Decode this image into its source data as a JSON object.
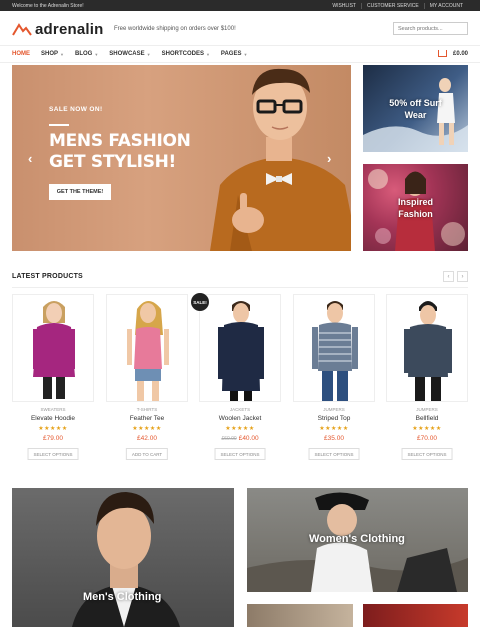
{
  "topbar": {
    "welcome": "Welcome to the Adrenalin Store!",
    "links": [
      "WISHLIST",
      "CUSTOMER SERVICE",
      "MY ACCOUNT"
    ]
  },
  "header": {
    "logo": "adrenalin",
    "tagline": "Free worldwide shipping on orders over $100!",
    "search_placeholder": "Search products..."
  },
  "nav": {
    "items": [
      "HOME",
      "SHOP",
      "BLOG",
      "SHOWCASE",
      "SHORTCODES",
      "PAGES"
    ],
    "cart_total": "£0.00",
    "accent": "#e4572e"
  },
  "hero": {
    "sale_tag": "SALE NOW ON!",
    "title": "MENS FASHION\nGET STYLISH!",
    "button": "GET THE THEME!",
    "prev_arrow": "‹",
    "next_arrow": "›"
  },
  "side_banners": [
    {
      "label": "50% off Surf\nWear"
    },
    {
      "label": "Inspired\nFashion"
    }
  ],
  "latest": {
    "title": "LATEST PRODUCTS",
    "prev": "‹",
    "next": "›",
    "sale_badge": "SALE!",
    "products": [
      {
        "category": "SWEATERS",
        "name": "Elevate Hoodie",
        "stars": "★★★★★",
        "price": "£79.00",
        "old_price": "",
        "action": "SELECT OPTIONS"
      },
      {
        "category": "T-SHIRTS",
        "name": "Feather Tee",
        "stars": "★★★★★",
        "price": "£42.00",
        "old_price": "",
        "action": "ADD TO CART"
      },
      {
        "category": "JACKETS",
        "name": "Woolen Jacket",
        "stars": "★★★★★",
        "price": "£40.00",
        "old_price": "£60.00",
        "action": "SELECT OPTIONS"
      },
      {
        "category": "JUMPERS",
        "name": "Striped Top",
        "stars": "★★★★★",
        "price": "£35.00",
        "old_price": "",
        "action": "SELECT OPTIONS"
      },
      {
        "category": "JUMPERS",
        "name": "Bellfield",
        "stars": "★★★★★",
        "price": "£70.00",
        "old_price": "",
        "action": "SELECT OPTIONS"
      }
    ]
  },
  "bottom_banners": {
    "men": "Men's Clothing",
    "women": "Women's Clothing"
  }
}
